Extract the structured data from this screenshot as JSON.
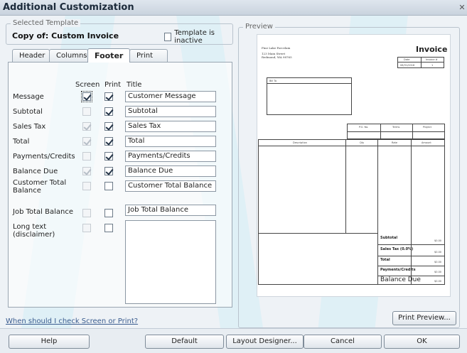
{
  "window": {
    "title": "Additional Customization"
  },
  "selected_template": {
    "legend": "Selected Template",
    "name": "Copy of: Custom Invoice",
    "inactive_label": "Template is inactive"
  },
  "tabs": [
    {
      "label": "Header",
      "active": false
    },
    {
      "label": "Columns",
      "active": false
    },
    {
      "label": "Footer",
      "active": true
    },
    {
      "label": "Print",
      "active": false
    }
  ],
  "footer": {
    "col_screen": "Screen",
    "col_print": "Print",
    "col_title": "Title",
    "rows": [
      {
        "label": "Message",
        "screen": true,
        "screen_enabled": true,
        "print": true,
        "title": "Customer Message"
      },
      {
        "label": "Subtotal",
        "screen": false,
        "screen_enabled": false,
        "print": true,
        "title": "Subtotal"
      },
      {
        "label": "Sales Tax",
        "screen": true,
        "screen_enabled": false,
        "print": true,
        "title": "Sales Tax"
      },
      {
        "label": "Total",
        "screen": true,
        "screen_enabled": false,
        "print": true,
        "title": "Total"
      },
      {
        "label": "Payments/Credits",
        "screen": false,
        "screen_enabled": false,
        "print": true,
        "title": "Payments/Credits"
      },
      {
        "label": "Balance Due",
        "screen": true,
        "screen_enabled": false,
        "print": true,
        "title": "Balance Due"
      },
      {
        "label": "Customer Total Balance",
        "screen": false,
        "screen_enabled": false,
        "print": false,
        "title": "Customer Total Balance"
      },
      {
        "label": "Job Total Balance",
        "screen": false,
        "screen_enabled": false,
        "print": false,
        "title": "Job Total Balance"
      },
      {
        "label": "Long text (disclaimer)",
        "screen": false,
        "screen_enabled": false,
        "print": false,
        "title": ""
      }
    ]
  },
  "help_link": "When should I check Screen or Print?",
  "preview": {
    "legend": "Preview",
    "company": [
      "Fine Lake Porcelain",
      "123 Main Street",
      "Redmond, WA 98765"
    ],
    "invoice_title": "Invoice",
    "hdr_cols": [
      "Date",
      "Invoice #"
    ],
    "hdr_vals": [
      "08/31/2016",
      "1"
    ],
    "bill_to": "Bill To",
    "mid_cols": [
      "P.O. No.",
      "Terms",
      "Project"
    ],
    "item_cols": [
      "Description",
      "Qty",
      "Rate",
      "Amount"
    ],
    "totals": [
      "Subtotal",
      "Sales Tax (0.0%)",
      "Total",
      "Payments/Credits",
      "Balance Due"
    ],
    "total_vals": [
      "$0.00",
      "$0.00",
      "$0.00",
      "$0.00",
      "$0.00"
    ],
    "print_preview_label": "Print Preview..."
  },
  "buttons": {
    "help": "Help",
    "default": "Default",
    "layout_designer": "Layout Designer...",
    "cancel": "Cancel",
    "ok": "OK"
  }
}
